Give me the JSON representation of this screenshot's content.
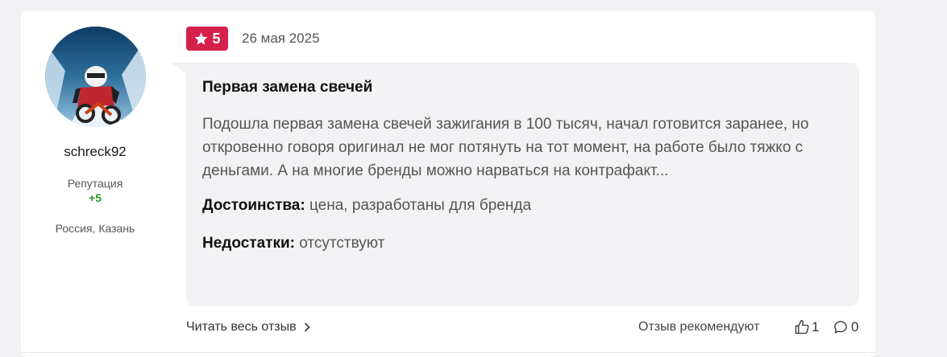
{
  "user": {
    "name": "schreck92",
    "reputation_label": "Репутация",
    "reputation_value": "+5",
    "location": "Россия, Казань",
    "avatar_icon": "motorcyclist-avatar"
  },
  "review": {
    "rating": "5",
    "date": "26 мая 2025",
    "title": "Первая замена свечей",
    "text": "Подошла первая замена свечей зажигания в 100 тысяч, начал готовится заранее, но откровенно говоря оригинал не мог потянуть на тот момент, на работе было тяжко с деньгами. А на многие бренды можно нарваться на контрафакт...",
    "pros_label": "Достоинства:",
    "pros_value": "цена, разработаны для бренда",
    "cons_label": "Недостатки:",
    "cons_value": "отсутствуют"
  },
  "footer": {
    "read_more": "Читать весь отзыв",
    "recommend": "Отзыв рекомендуют",
    "likes": "1",
    "comments": "0"
  },
  "colors": {
    "rating_badge": "#d6214d",
    "reputation_positive": "#2a9d2a",
    "bubble_bg": "#f2f2f4"
  }
}
